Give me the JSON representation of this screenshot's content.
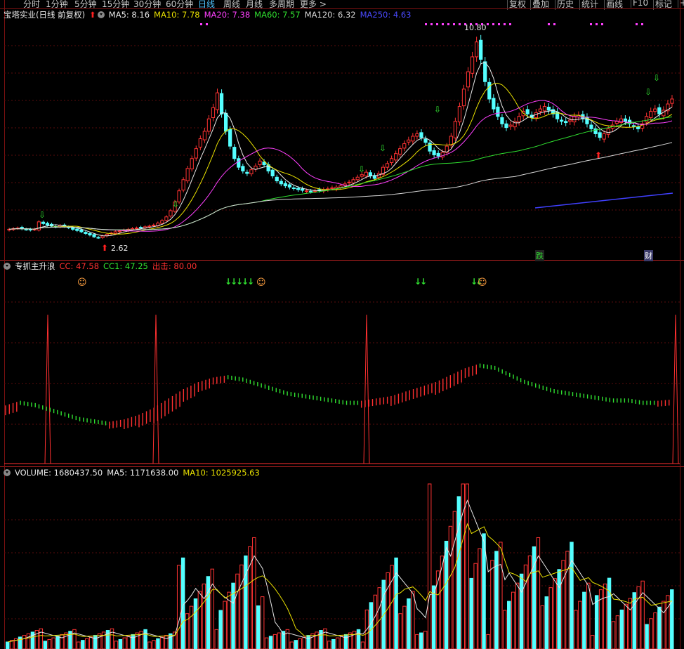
{
  "tabs": [
    "分时",
    "1分钟",
    "5分钟",
    "15分钟",
    "30分钟",
    "60分钟",
    "日线",
    "周线",
    "月线",
    "多周期",
    "更多 >"
  ],
  "active_tab": "日线",
  "toolbar": [
    "复权",
    "叠加",
    "历史",
    "统计",
    "画线",
    "F10",
    "标记",
    "+"
  ],
  "main": {
    "stock_name": "宝塔实业(日线 前复权)",
    "ma": [
      {
        "label": "MA5: 8.16",
        "color": "#e8e8e8"
      },
      {
        "label": "MA10: 7.78",
        "color": "#e8e000"
      },
      {
        "label": "MA20: 7.38",
        "color": "#ff40ff"
      },
      {
        "label": "MA60: 7.57",
        "color": "#30e030"
      },
      {
        "label": "MA120: 6.32",
        "color": "#d8d8d8"
      },
      {
        "label": "MA250: 4.63",
        "color": "#4a4aff"
      }
    ],
    "high_label": "10.80",
    "low_label": "2.62",
    "tag_die": "跌",
    "tag_cai": "财"
  },
  "ind": {
    "name": "专抓主升浪",
    "cc": "CC: 47.58",
    "cc1": "CC1: 47.25",
    "out": "出击: 80.00",
    "colors": {
      "cc": "#ff3030",
      "cc1": "#30e030",
      "out": "#ff3030"
    }
  },
  "vol": {
    "vol": "VOLUME: 1680437.50",
    "ma5": "MA5: 1171638.00",
    "ma10": "MA10: 1025925.63"
  },
  "chart_data": [
    {
      "type": "candlestick",
      "title": "宝塔实业(日线 前复权)",
      "close": [
        2.95,
        2.98,
        3.0,
        2.97,
        2.95,
        2.92,
        2.95,
        3.25,
        3.18,
        3.12,
        3.08,
        3.05,
        3.1,
        3.07,
        3.02,
        2.95,
        2.9,
        2.85,
        2.78,
        2.72,
        2.65,
        2.62,
        2.68,
        2.75,
        2.8,
        2.85,
        2.88,
        2.92,
        2.95,
        2.98,
        3.0,
        3.02,
        3.05,
        3.08,
        3.12,
        3.2,
        3.3,
        3.45,
        3.7,
        4.05,
        4.5,
        4.95,
        5.4,
        5.8,
        6.2,
        6.6,
        6.9,
        7.4,
        7.85,
        8.45,
        7.6,
        6.9,
        6.3,
        5.8,
        5.45,
        5.3,
        5.2,
        5.35,
        5.5,
        5.7,
        5.55,
        5.3,
        5.1,
        4.9,
        4.78,
        4.7,
        4.65,
        4.6,
        4.55,
        4.52,
        4.5,
        4.48,
        4.5,
        4.52,
        4.55,
        4.58,
        4.62,
        4.65,
        4.7,
        4.78,
        4.85,
        4.95,
        5.05,
        5.15,
        5.25,
        5.1,
        5.0,
        5.2,
        5.45,
        5.6,
        5.8,
        6.0,
        6.2,
        6.4,
        6.55,
        6.7,
        6.8,
        6.65,
        6.45,
        6.1,
        5.95,
        5.9,
        6.05,
        6.3,
        6.7,
        7.3,
        7.9,
        8.6,
        9.3,
        9.9,
        10.5,
        9.8,
        8.9,
        8.2,
        7.8,
        7.5,
        7.2,
        7.05,
        7.15,
        7.3,
        7.5,
        7.7,
        7.6,
        7.45,
        7.65,
        7.8,
        7.9,
        7.75,
        7.6,
        7.4,
        7.3,
        7.25,
        7.35,
        7.5,
        7.55,
        7.4,
        7.2,
        7.0,
        6.8,
        6.65,
        6.8,
        7.0,
        7.15,
        7.3,
        7.4,
        7.3,
        7.2,
        7.1,
        7.0,
        7.2,
        7.5,
        7.7,
        7.8,
        7.6,
        7.75,
        8.0,
        8.2
      ],
      "ma_current": {
        "MA5": 8.16,
        "MA10": 7.78,
        "MA20": 7.38,
        "MA60": 7.57,
        "MA120": 6.32,
        "MA250": 4.63
      },
      "high": 10.8,
      "low": 2.62
    },
    {
      "type": "line",
      "title": "专抓主升浪",
      "series": [
        {
          "name": "CC",
          "values": [
            45,
            47,
            46,
            44,
            42,
            40,
            39,
            38,
            39,
            41,
            44,
            48,
            52,
            55,
            57,
            58,
            57,
            55,
            53,
            51,
            50,
            49,
            48,
            47,
            47,
            48,
            49,
            51,
            53,
            55,
            58,
            61,
            63,
            62,
            59,
            56,
            54,
            52,
            51,
            50,
            49,
            48,
            48,
            47,
            47,
            47.58
          ]
        },
        {
          "name": "出击",
          "values": [
            80
          ]
        }
      ]
    },
    {
      "type": "bar",
      "title": "VOLUME",
      "series": [
        {
          "name": "VOLUME",
          "values": [
            1680437.5
          ]
        },
        {
          "name": "MA5",
          "values": [
            1171638.0
          ]
        },
        {
          "name": "MA10",
          "values": [
            1025925.63
          ]
        }
      ]
    }
  ]
}
